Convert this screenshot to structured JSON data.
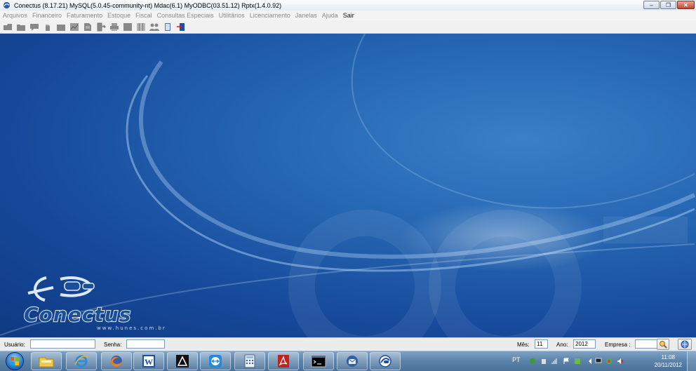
{
  "window": {
    "title": "Conectus (8.17.21)  MySQL(5.0.45-community-nt)  Mdac(6.1) MyODBC(03.51.12) Rptx(1.4.0.92)",
    "minimize_label": "–",
    "restore_label": "❐",
    "close_label": "✕"
  },
  "menu": {
    "items": [
      "Arquivos",
      "Financeiro",
      "Faturamento",
      "Estoque",
      "Fiscal",
      "Consultas Especiais",
      "Utilitários",
      "Licenciamento",
      "Janelas",
      "Ajuda",
      "Sair"
    ]
  },
  "toolbar": {
    "icons": [
      "open-icon",
      "folder-icon",
      "message-icon",
      "hand-icon",
      "box-icon",
      "chart-icon",
      "document-icon",
      "import-icon",
      "printer-icon",
      "grid-icon",
      "barcode-icon",
      "users-icon",
      "book-icon",
      "exit-door-icon"
    ]
  },
  "brand": {
    "name": "Conectus",
    "website": "www.hunes.com.br"
  },
  "statusbar": {
    "user_label": "Usuário:",
    "user_value": "",
    "password_label": "Senha:",
    "password_value": "",
    "month_label": "Mês:",
    "month_value": "11",
    "year_label": "Ano:",
    "year_value": "2012",
    "company_label": "Empresa :",
    "company_value": ""
  },
  "taskbar": {
    "apps": [
      "windows-explorer-icon",
      "internet-explorer-icon",
      "firefox-icon",
      "word-icon",
      "autocad-icon",
      "teamviewer-icon",
      "calculator-icon",
      "acrobat-icon",
      "cmd-icon",
      "thunderbird-icon",
      "conectus-icon"
    ],
    "language": "PT",
    "time": "11:08",
    "date": "20/11/2012"
  },
  "colors": {
    "desktop_blue": "#1f5ba8",
    "menu_active": "#111111",
    "menu_disabled": "#8a8a8a"
  }
}
